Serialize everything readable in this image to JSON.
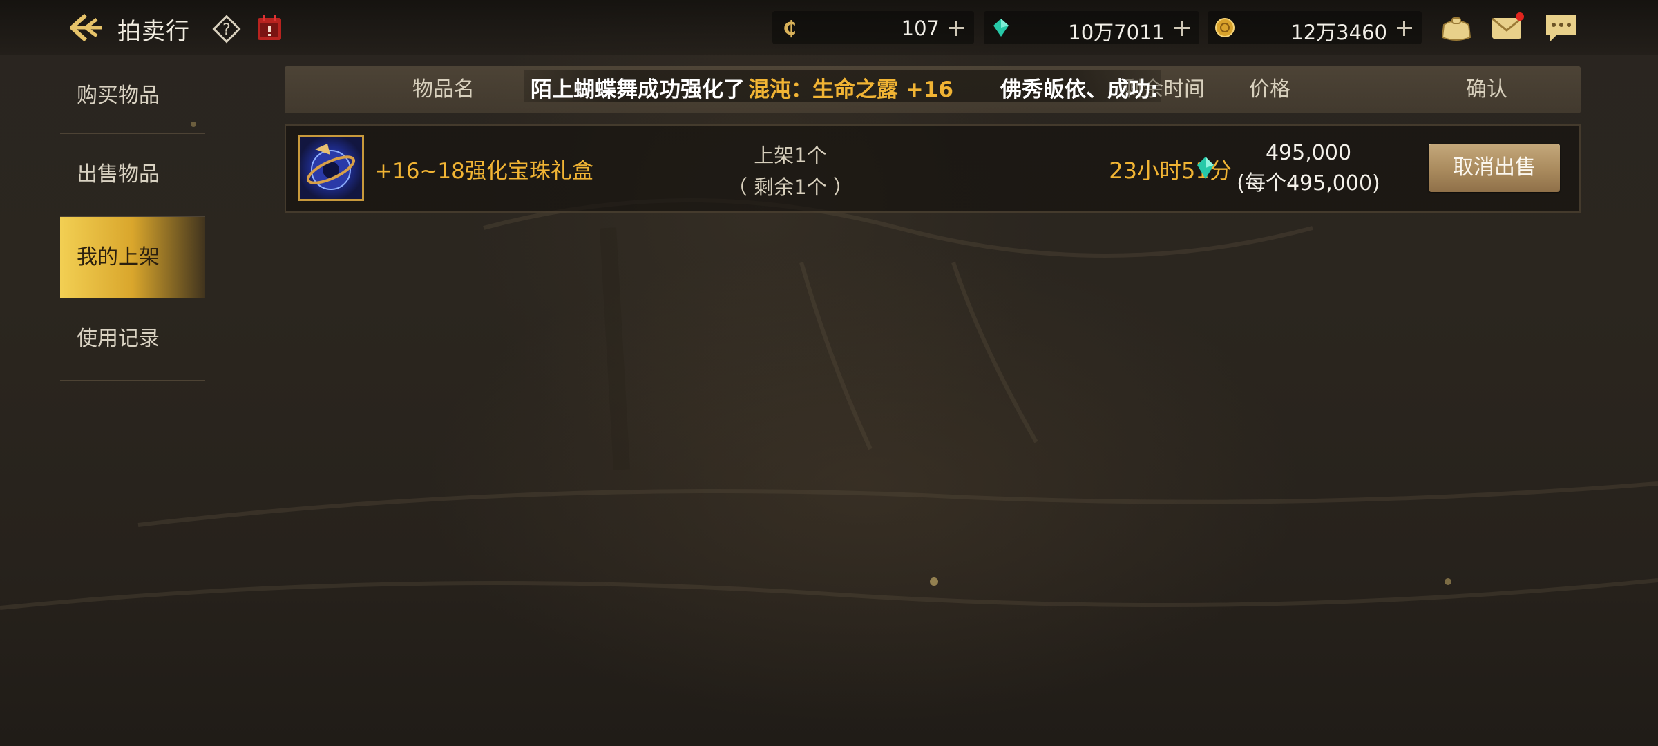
{
  "header": {
    "title": "拍卖行",
    "currencies": [
      {
        "icon": "coupon-icon",
        "value": "107"
      },
      {
        "icon": "gem-icon",
        "value": "10万7011"
      },
      {
        "icon": "gold-coin-icon",
        "value": "12万3460"
      }
    ]
  },
  "sidebar": {
    "items": [
      {
        "label": "购买物品",
        "active": false
      },
      {
        "label": "出售物品",
        "active": false
      },
      {
        "label": "我的上架",
        "active": true
      },
      {
        "label": "使用记录",
        "active": false
      }
    ]
  },
  "table": {
    "headers": {
      "name": "物品名",
      "remaining": "剩余时间",
      "price": "价格",
      "confirm": "确认"
    }
  },
  "ticker": {
    "part1": "陌上蝴蝶舞成功强化了",
    "part2": "混沌：生命之露 +16",
    "part3": "佛秀皈依、成功:"
  },
  "listing": {
    "item_name": "+16~18强化宝珠礼盒",
    "listed_qty": "上架1个",
    "remaining_qty": "（ 剩余1个 ）",
    "time_left": "23小时51分",
    "price_total": "495,000",
    "price_each": "(每个495,000)",
    "action_label": "取消出售"
  },
  "colors": {
    "accent_gold": "#f1b434",
    "active_tab": "#f2cf53",
    "button": "#b0915f"
  }
}
